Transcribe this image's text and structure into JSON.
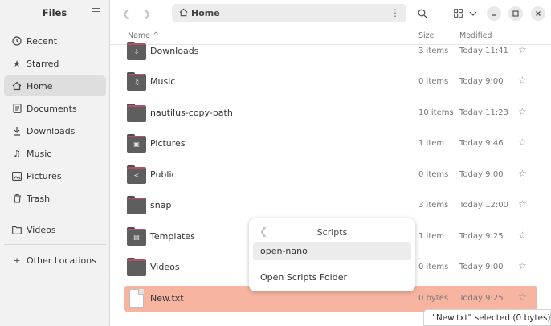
{
  "sidebar": {
    "title": "Files",
    "items": [
      {
        "label": "Recent",
        "icon": "clock-icon"
      },
      {
        "label": "Starred",
        "icon": "star-icon"
      },
      {
        "label": "Home",
        "icon": "home-icon",
        "active": true
      },
      {
        "label": "Documents",
        "icon": "document-icon"
      },
      {
        "label": "Downloads",
        "icon": "download-icon"
      },
      {
        "label": "Music",
        "icon": "music-icon"
      },
      {
        "label": "Pictures",
        "icon": "picture-icon"
      },
      {
        "label": "Trash",
        "icon": "trash-icon"
      },
      {
        "label": "Videos",
        "icon": "folder-icon"
      },
      {
        "label": "Other Locations",
        "icon": "plus-icon"
      }
    ]
  },
  "pathbar": {
    "location": "Home"
  },
  "columns": {
    "name": "Name",
    "size": "Size",
    "modified": "Modified"
  },
  "files": [
    {
      "name": "Downloads",
      "size": "3 items",
      "modified": "Today 11:41",
      "emblem": "download-icon"
    },
    {
      "name": "Music",
      "size": "0 items",
      "modified": "Today 9:00",
      "emblem": "music-icon"
    },
    {
      "name": "nautilus-copy-path",
      "size": "10 items",
      "modified": "Today 11:23",
      "emblem": ""
    },
    {
      "name": "Pictures",
      "size": "1 item",
      "modified": "Today 9:46",
      "emblem": "picture-icon"
    },
    {
      "name": "Public",
      "size": "0 items",
      "modified": "Today 9:00",
      "emblem": "share-icon"
    },
    {
      "name": "snap",
      "size": "3 items",
      "modified": "Today 12:00",
      "emblem": ""
    },
    {
      "name": "Templates",
      "size": "1 item",
      "modified": "Today 9:25",
      "emblem": "template-icon"
    },
    {
      "name": "Videos",
      "size": "0 items",
      "modified": "Today 9:00",
      "emblem": ""
    },
    {
      "name": "New.txt",
      "size": "0 bytes",
      "modified": "Today 9:25",
      "selected": true,
      "type": "file"
    }
  ],
  "popover": {
    "title": "Scripts",
    "items": [
      "open-nano",
      "Open Scripts Folder"
    ]
  },
  "status": "\"New.txt\" selected (0 bytes)",
  "colors": {
    "selection": "#f7b5a1",
    "folder_accent": "#b25068",
    "folder_body": "#5e5e5e"
  }
}
